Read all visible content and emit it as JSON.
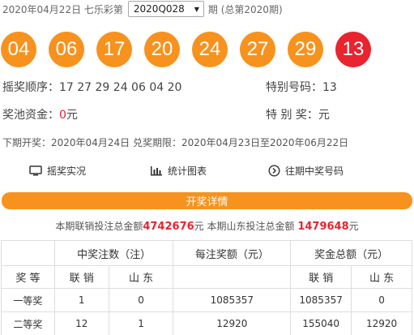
{
  "header": {
    "date_text": "2020年04月22日 七乐彩第",
    "issue_selected": "2020Q028",
    "total_text": "期 (总第2020期)"
  },
  "balls": {
    "regular": [
      "04",
      "06",
      "17",
      "20",
      "24",
      "27",
      "29"
    ],
    "special": "13",
    "regular_color": "#f7921e",
    "special_color": "#e8242f"
  },
  "draw_order": {
    "label": "摇奖顺序：",
    "value": "17 27 29 24 06 04 20"
  },
  "special_number": {
    "label": "特别号码：",
    "value": "13"
  },
  "pool": {
    "label": "奖池资金：",
    "amount": "0",
    "unit": "元"
  },
  "special_prize": {
    "label": "特 别 奖：",
    "unit": "元"
  },
  "schedule": {
    "next_draw_label": "下期开奖：",
    "next_draw_date": "2020年04月24日",
    "redeem_label": "兑奖期限：",
    "redeem_range": "2020年04月23日至2020年06月22日"
  },
  "links": {
    "live": "摇奖实况",
    "charts": "统计图表",
    "history": "往期中奖号码"
  },
  "detail_bar": "开奖详情",
  "sales": {
    "prefix": "本期联销投注总金额",
    "union_amount": "4742676",
    "unit1": "元 本期山东投注总金额",
    "shandong_amount": "1479648",
    "unit2": "元"
  },
  "table": {
    "col_prize": "奖 等",
    "col_count": "中奖注数（注）",
    "col_per": "每注奖额（元）",
    "col_total": "奖金总额（元）",
    "sub_union": "联 销",
    "sub_sd": "山 东",
    "rows": [
      {
        "name": "一等奖",
        "cnt_union": "1",
        "cnt_sd": "0",
        "per": "1085357",
        "tot_union": "1085357",
        "tot_sd": "0"
      },
      {
        "name": "二等奖",
        "cnt_union": "12",
        "cnt_sd": "1",
        "per": "12920",
        "tot_union": "155040",
        "tot_sd": "12920"
      }
    ]
  }
}
